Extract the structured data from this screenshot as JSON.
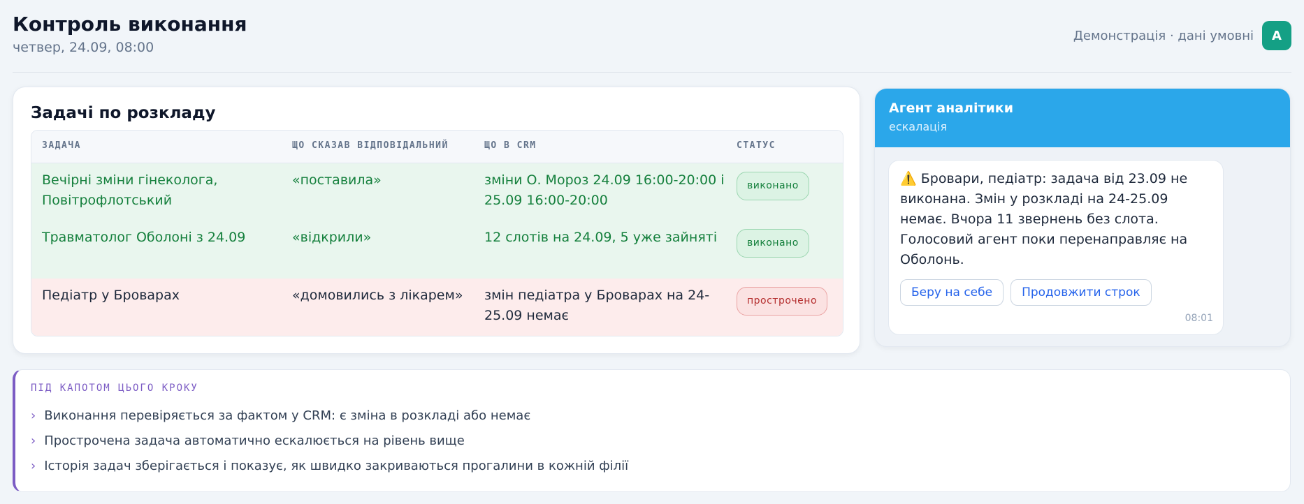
{
  "header": {
    "title": "Контроль виконання",
    "subtitle": "четвер, 24.09, 08:00",
    "demo_note": "Демонстрація · дані умовні",
    "avatar_letter": "А"
  },
  "tasks": {
    "title": "Задачі по розкладу",
    "columns": [
      "ЗАДАЧА",
      "ЩО СКАЗАВ ВІДПОВІДАЛЬНИЙ",
      "ЩО В CRM",
      "СТАТУС"
    ],
    "rows": [
      {
        "task": "Вечірні зміни гінеколога, Повітрофлотський",
        "said": "«поставила»",
        "crm": "зміни О. Мороз 24.09 16:00-20:00 і 25.09 16:00-20:00",
        "status": "виконано",
        "state": "done"
      },
      {
        "task": "Травматолог Оболоні з 24.09",
        "said": "«відкрили»",
        "crm": "12 слотів на 24.09, 5 уже зайняті",
        "status": "виконано",
        "state": "done"
      },
      {
        "task": "Педіатр у Броварах",
        "said": "«домовились з лікарем»",
        "crm": "змін педіатра у Броварах на 24-25.09 немає",
        "status": "прострочено",
        "state": "overdue"
      }
    ]
  },
  "agent": {
    "title": "Агент аналітики",
    "subtitle": "ескалація",
    "warning_icon": "warning-icon",
    "message": "Бровари, педіатр: задача від 23.09 не виконана. Змін у розкладі на 24-25.09 немає. Вчора 11 звернень без слота. Голосовий агент поки перенаправляє на Оболонь.",
    "buttons": {
      "take": "Беру на себе",
      "extend": "Продовжити строк"
    },
    "time": "08:01"
  },
  "under_the_hood": {
    "title": "ПІД КАПОТОМ ЦЬОГО КРОКУ",
    "items": [
      "Виконання перевіряється за фактом у CRM: є зміна в розкладі або немає",
      "Прострочена задача автоматично ескалюється на рівень вище",
      "Історія задач зберігається і показує, як швидко закриваються прогалини в кожній філії"
    ]
  },
  "colors": {
    "accent_blue": "#2ba7ea",
    "done_green": "#15803d",
    "overdue_red": "#b42d2d",
    "purple": "#7c5cc4",
    "avatar_teal": "#14a085"
  }
}
